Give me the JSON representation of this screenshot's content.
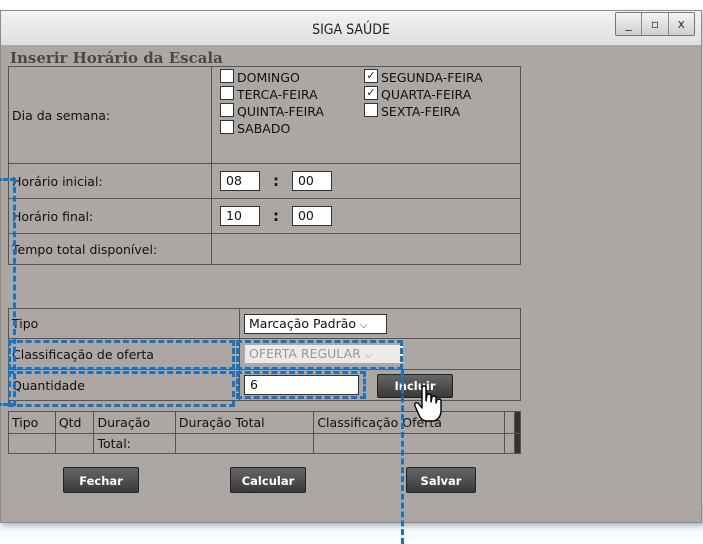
{
  "window": {
    "title": "SIGA SAÚDE",
    "buttons": [
      "_",
      "▫",
      "x"
    ]
  },
  "section_title": "Inserir Horário da Escala",
  "days": {
    "label": "Dia da semana:",
    "items": [
      {
        "label": "DOMINGO",
        "checked": false
      },
      {
        "label": "SEGUNDA-FEIRA",
        "checked": true
      },
      {
        "label": "TERCA-FEIRA",
        "checked": false
      },
      {
        "label": "QUARTA-FEIRA",
        "checked": true
      },
      {
        "label": "QUINTA-FEIRA",
        "checked": false
      },
      {
        "label": "SEXTA-FEIRA",
        "checked": false
      },
      {
        "label": "SABADO",
        "checked": false
      }
    ],
    "check_mark": "✓"
  },
  "time": {
    "start_label": "Horário inicial:",
    "start_hour": "08",
    "start_min": "00",
    "end_label": "Horário final:",
    "end_hour": "10",
    "end_min": "00",
    "total_label": "Tempo total disponível:",
    "separator": ":"
  },
  "offer": {
    "tipo_label": "Tipo",
    "tipo_value": "Marcação Padrão",
    "classificacao_label": "Classificação de oferta",
    "classificacao_value": "OFERTA REGULAR",
    "quantidade_label": "Quantidade",
    "quantidade_value": "6",
    "incluir_label": "Incluir"
  },
  "grid": {
    "headers": [
      "Tipo",
      "Qtd",
      "Duração",
      "Duração Total",
      "Classificação Oferta"
    ],
    "total_label": "Total:"
  },
  "footer": {
    "fechar": "Fechar",
    "calcular": "Calcular",
    "salvar": "Salvar"
  },
  "colors": {
    "highlight": "#1873c4",
    "window_bg": "#aca7a3",
    "button_bg": "#4a4a4a"
  }
}
